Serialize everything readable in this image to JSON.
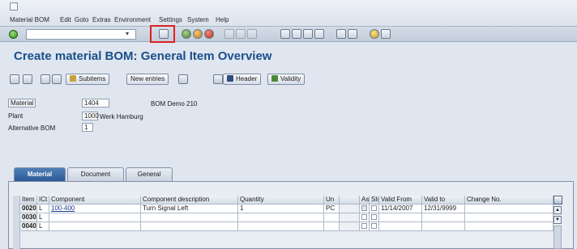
{
  "menu": [
    "Material BOM",
    "Edit",
    "Goto",
    "Extras",
    "Environment",
    "Settings",
    "System",
    "Help"
  ],
  "title": "Create material BOM: General Item Overview",
  "app_toolbar": {
    "subitems_label": "Subitems",
    "new_entries_label": "New entries",
    "header_label": "Header",
    "validity_label": "Validity"
  },
  "header_fields": {
    "material_label": "Material",
    "material_value": "1404",
    "material_desc": "BOM Demo 210",
    "plant_label": "Plant",
    "plant_value": "1000",
    "plant_desc": "Werk Hamburg",
    "alt_bom_label": "Alternative BOM",
    "alt_bom_value": "1"
  },
  "tabs": [
    "Material",
    "Document",
    "General"
  ],
  "table": {
    "headers": [
      "Item",
      "ICt",
      "Component",
      "Component description",
      "Quantity",
      "Un",
      "As.",
      "Sls",
      "Valid From",
      "Valid to",
      "Change No."
    ],
    "rows": [
      [
        "0020",
        "L",
        "100-400",
        "Turn Signal Left",
        "1",
        "PC",
        "",
        "",
        "11/14/2007",
        "12/31/9999",
        ""
      ],
      [
        "0030",
        "L",
        "",
        "",
        "",
        "",
        "",
        "",
        "",
        "",
        ""
      ],
      [
        "0040",
        "L",
        "",
        "",
        "",
        "",
        "",
        "",
        "",
        "",
        ""
      ]
    ]
  },
  "colors": {
    "title": "#1a4f8a",
    "active_tab": "#2c5a94",
    "highlight": "#e02020"
  }
}
